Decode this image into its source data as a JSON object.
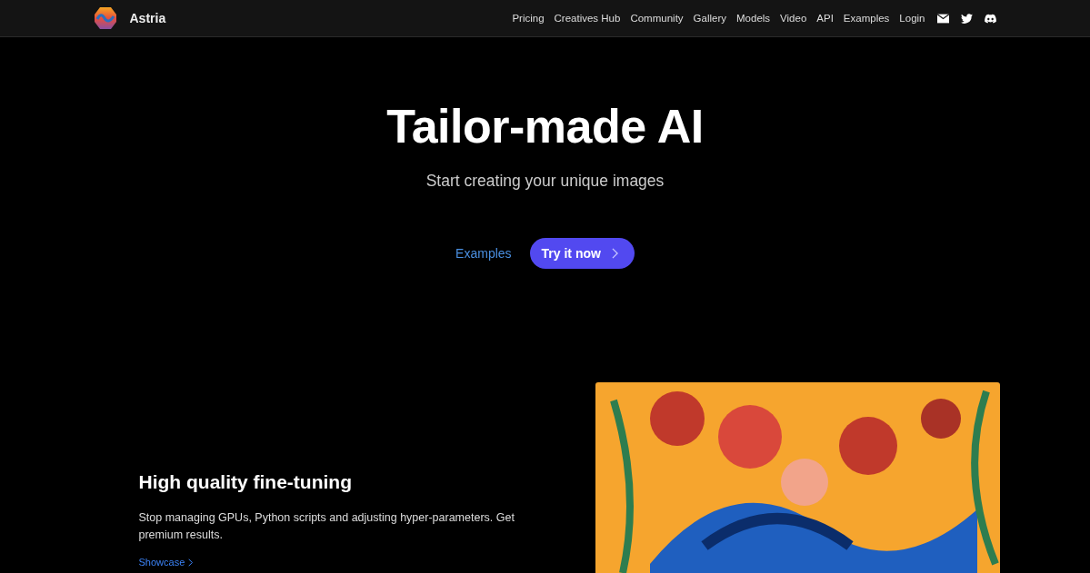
{
  "nav": {
    "brand": "Astria",
    "links": [
      "Pricing",
      "Creatives Hub",
      "Community",
      "Gallery",
      "Models",
      "Video",
      "API",
      "Examples",
      "Login"
    ],
    "icons": [
      {
        "kind": "mail"
      },
      {
        "kind": "twitter"
      },
      {
        "kind": "discord"
      }
    ]
  },
  "hero": {
    "title": "Tailor-made AI",
    "subtitle": "Start creating your unique images",
    "secondary_button": "Examples",
    "primary_button": "Try it now"
  },
  "feature": {
    "title": "High quality fine-tuning",
    "text": "Stop managing GPUs, Python scripts and adjusting hyper-parameters. Get premium results.",
    "link": "Showcase"
  }
}
